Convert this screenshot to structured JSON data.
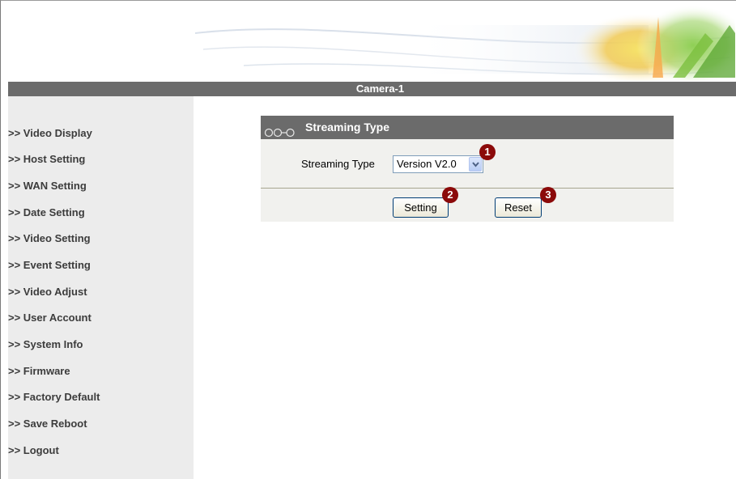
{
  "header": {
    "title": "Camera-1"
  },
  "sidebar": {
    "items": [
      {
        "label": ">> Video Display"
      },
      {
        "label": ">> Host Setting"
      },
      {
        "label": ">> WAN Setting"
      },
      {
        "label": ">> Date Setting"
      },
      {
        "label": ">> Video Setting"
      },
      {
        "label": ">> Event Setting"
      },
      {
        "label": ">> Video Adjust"
      },
      {
        "label": ">> User Account"
      },
      {
        "label": ">> System Info"
      },
      {
        "label": ">> Firmware"
      },
      {
        "label": ">> Factory Default"
      },
      {
        "label": ">> Save Reboot"
      },
      {
        "label": ">> Logout"
      }
    ]
  },
  "panel": {
    "title": "Streaming Type",
    "icon": "chain-links-icon",
    "streaming_type_label": "Streaming Type",
    "streaming_type_value": "Version V2.0",
    "setting_button": "Setting",
    "reset_button": "Reset"
  },
  "markers": [
    "1",
    "2",
    "3"
  ],
  "colors": {
    "title_bar": "#6b6b6b",
    "sidebar_bg": "#ececec",
    "panel_bg": "#f1f1ee",
    "marker": "#8b0a0a"
  }
}
